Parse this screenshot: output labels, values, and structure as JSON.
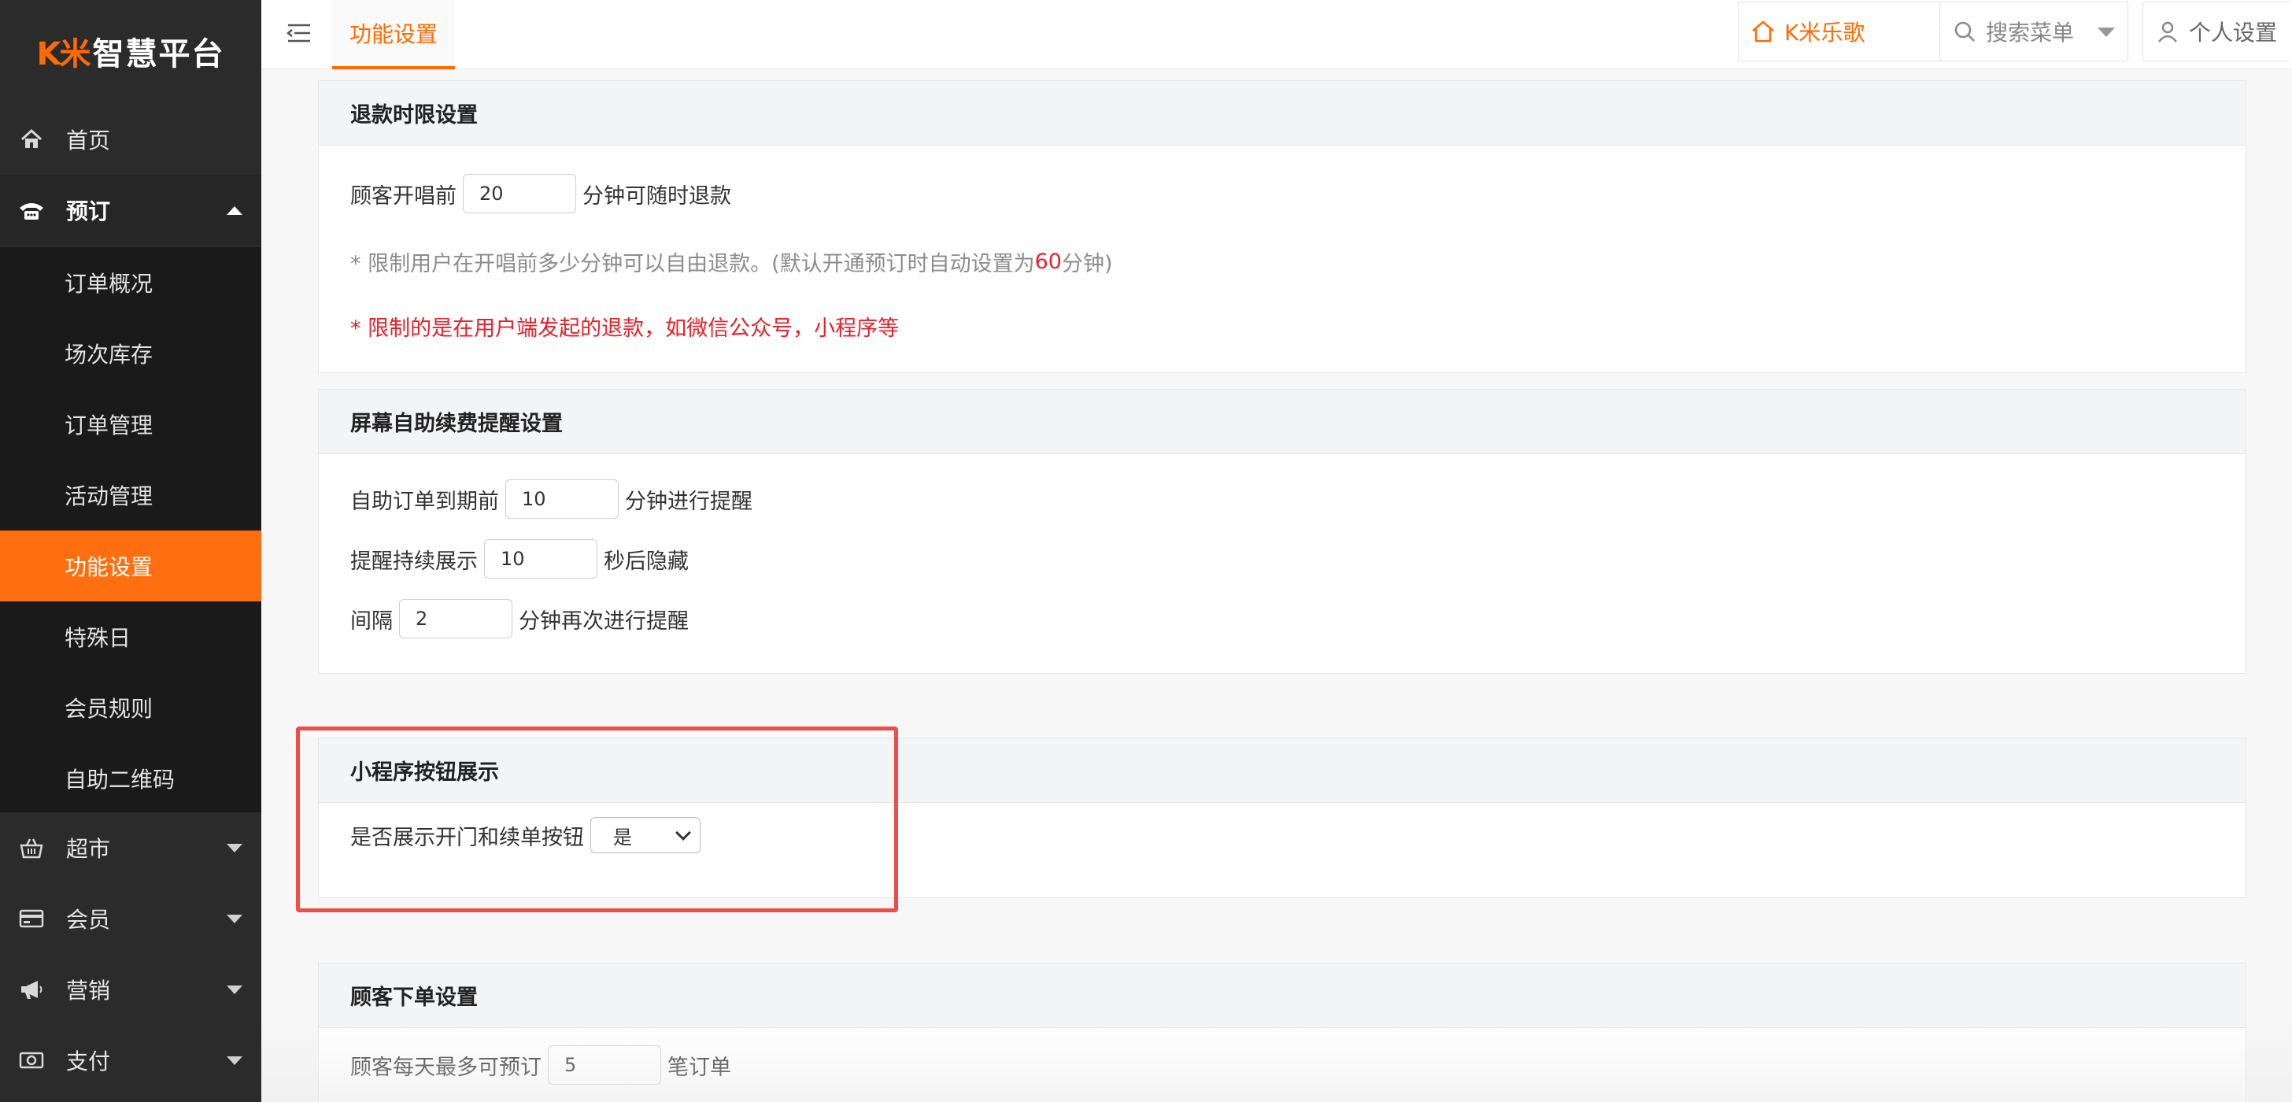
{
  "logo": {
    "mark": "K米",
    "text": "智慧平台"
  },
  "sidebar": {
    "items": [
      {
        "label": "首页",
        "icon": "home-icon"
      },
      {
        "label": "预订",
        "icon": "phone-icon"
      },
      {
        "label": "超市",
        "icon": "basket-icon"
      },
      {
        "label": "会员",
        "icon": "card-icon"
      },
      {
        "label": "营销",
        "icon": "megaphone-icon"
      },
      {
        "label": "支付",
        "icon": "money-icon"
      }
    ],
    "submenu": [
      "订单概况",
      "场次库存",
      "订单管理",
      "活动管理",
      "功能设置",
      "特殊日",
      "会员规则",
      "自助二维码"
    ]
  },
  "topbar": {
    "active_tab": "功能设置",
    "store": "K米乐歌",
    "search_placeholder": "搜索菜单",
    "profile": "个人设置"
  },
  "refund": {
    "title": "退款时限设置",
    "prefix": "顾客开唱前",
    "value": "20",
    "suffix": "分钟可随时退款",
    "hint_a": "* 限制用户在开唱前多少分钟可以自由退款。(默认开通预订时自动设置为",
    "hint_num": "60",
    "hint_b": "分钟)",
    "hint_red": "* 限制的是在用户端发起的退款，如微信公众号，小程序等"
  },
  "renewal": {
    "title": "屏幕自助续费提醒设置",
    "r1_prefix": "自助订单到期前",
    "r1_value": "10",
    "r1_suffix": "分钟进行提醒",
    "r2_prefix": "提醒持续展示",
    "r2_value": "10",
    "r2_suffix": "秒后隐藏",
    "r3_prefix": "间隔",
    "r3_value": "2",
    "r3_suffix": "分钟再次进行提醒"
  },
  "miniapp": {
    "title": "小程序按钮展示",
    "label": "是否展示开门和续单按钮",
    "value": "是"
  },
  "order": {
    "title": "顾客下单设置",
    "prefix": "顾客每天最多可预订",
    "value": "5",
    "suffix": "笔订单"
  },
  "colors": {
    "accent": "#ff6b00",
    "sidebar": "#2b2b2b",
    "highlight": "#ef4b4b",
    "hint_red": "#e8202a"
  }
}
